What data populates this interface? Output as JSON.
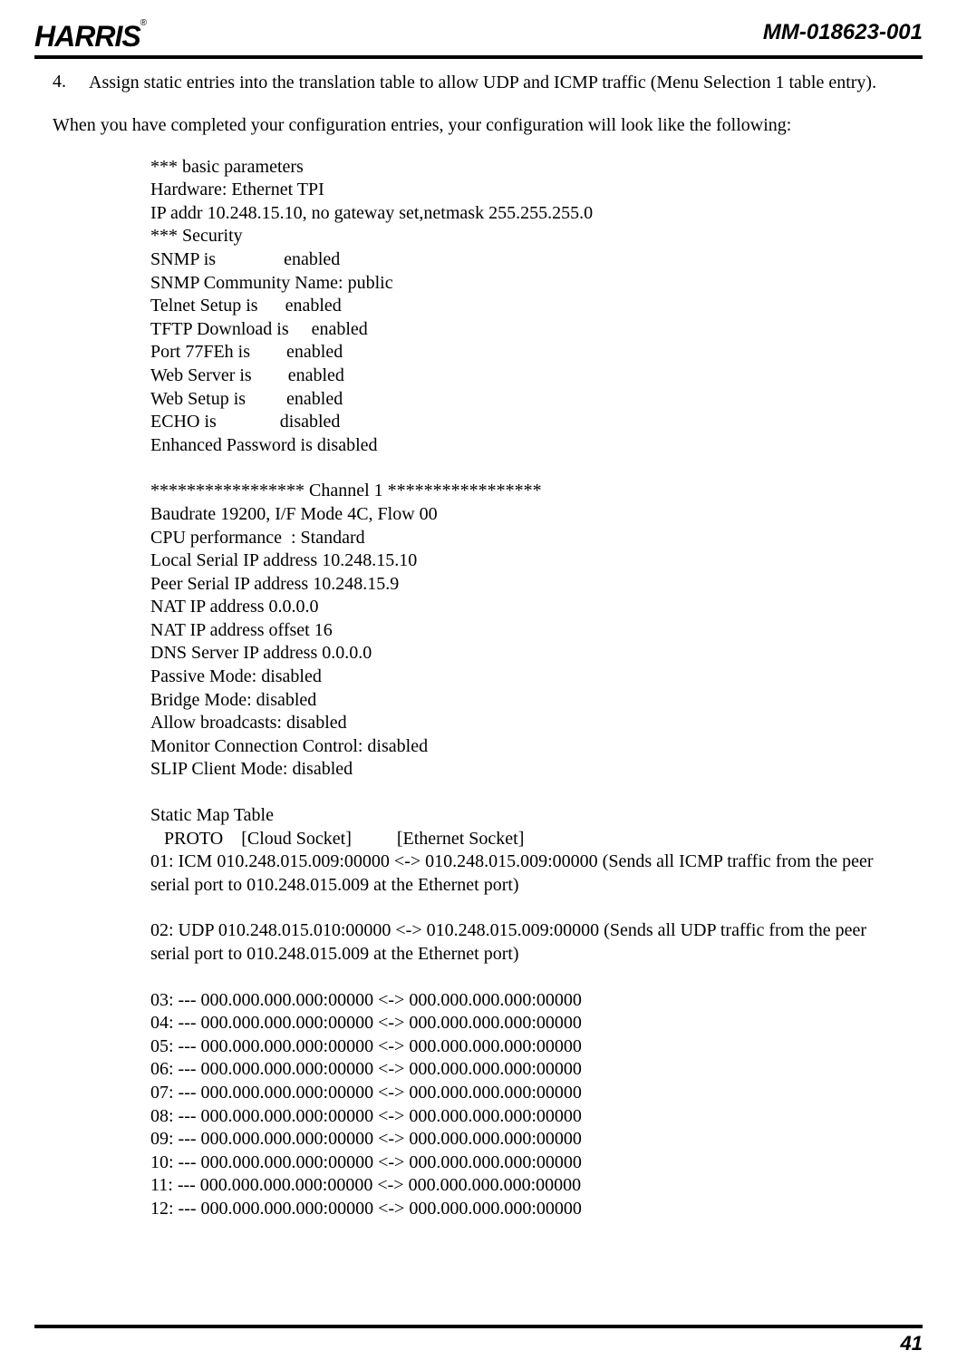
{
  "header": {
    "logo_text": "HARRIS",
    "doc_code": "MM-018623-001"
  },
  "step": {
    "number": "4.",
    "text": "Assign static entries into the translation table to allow UDP and ICMP traffic (Menu Selection 1 table entry)."
  },
  "intro": "When you have completed your configuration entries, your configuration will look like the following:",
  "config": {
    "basic_header": "*** basic parameters",
    "hardware": "Hardware: Ethernet TPI",
    "ip_addr": "IP addr 10.248.15.10, no gateway set,netmask 255.255.255.0",
    "security_header": "*** Security",
    "snmp": "SNMP is               enabled",
    "snmp_community": "SNMP Community Name: public",
    "telnet": "Telnet Setup is      enabled",
    "tftp": "TFTP Download is     enabled",
    "port77": "Port 77FEh is        enabled",
    "webserver": "Web Server is        enabled",
    "websetup": "Web Setup is         enabled",
    "echo": "ECHO is              disabled",
    "enhanced_pw": "Enhanced Password is disabled",
    "channel_header": "***************** Channel 1 *****************",
    "baudrate": "Baudrate 19200, I/F Mode 4C, Flow 00",
    "cpu_perf": "CPU performance  : Standard",
    "local_serial": "Local Serial IP address 10.248.15.10",
    "peer_serial": "Peer Serial IP address 10.248.15.9",
    "nat_ip": "NAT IP address 0.0.0.0",
    "nat_offset": "NAT IP address offset 16",
    "dns": "DNS Server IP address 0.0.0.0",
    "passive": "Passive Mode: disabled",
    "bridge": "Bridge Mode: disabled",
    "broadcasts": "Allow broadcasts: disabled",
    "monitor": "Monitor Connection Control: disabled",
    "slip": "SLIP Client Mode: disabled",
    "static_map_header": "Static Map Table",
    "proto_header": "   PROTO    [Cloud Socket]          [Ethernet Socket]",
    "entry01": "01: ICM 010.248.015.009:00000 <-> 010.248.015.009:00000 (Sends all ICMP traffic from the peer serial port to 010.248.015.009 at the Ethernet port)",
    "entry02": "02: UDP 010.248.015.010:00000 <-> 010.248.015.009:00000 (Sends all UDP traffic from the peer serial port to 010.248.015.009 at the Ethernet port)",
    "entry03": "03: --- 000.000.000.000:00000 <-> 000.000.000.000:00000",
    "entry04": "04: --- 000.000.000.000:00000 <-> 000.000.000.000:00000",
    "entry05": "05: --- 000.000.000.000:00000 <-> 000.000.000.000:00000",
    "entry06": "06: --- 000.000.000.000:00000 <-> 000.000.000.000:00000",
    "entry07": "07: --- 000.000.000.000:00000 <-> 000.000.000.000:00000",
    "entry08": "08: --- 000.000.000.000:00000 <-> 000.000.000.000:00000",
    "entry09": "09: --- 000.000.000.000:00000 <-> 000.000.000.000:00000",
    "entry10": "10: --- 000.000.000.000:00000 <-> 000.000.000.000:00000",
    "entry11": "11: --- 000.000.000.000:00000 <-> 000.000.000.000:00000",
    "entry12": "12: --- 000.000.000.000:00000 <-> 000.000.000.000:00000"
  },
  "page_number": "41"
}
